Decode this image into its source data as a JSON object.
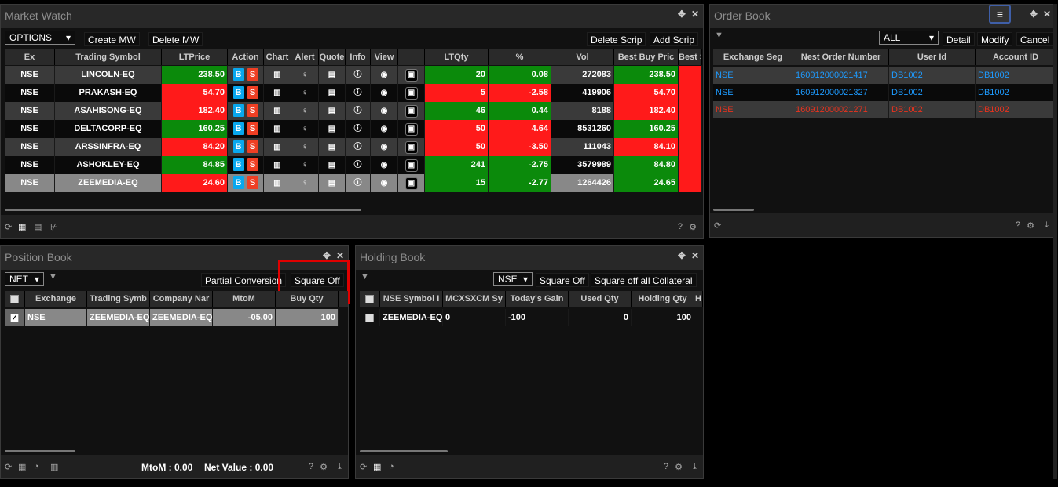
{
  "market_watch": {
    "title": "Market Watch",
    "mw_select": "OPTIONS",
    "create_mw": "Create MW",
    "delete_mw": "Delete MW",
    "delete_scrip": "Delete Scrip",
    "add_scrip": "Add Scrip",
    "columns": [
      "Ex",
      "Trading Symbol",
      "LTPrice",
      "Action",
      "Chart",
      "Alert",
      "Quote",
      "Info",
      "View",
      "",
      "LTQty",
      "%",
      "Vol",
      "Best Buy Pric",
      "Best S"
    ],
    "buy_label": "B",
    "sell_label": "S",
    "rows": [
      {
        "ex": "NSE",
        "sym": "LINCOLN-EQ",
        "ltp": "238.50",
        "ltp_c": "g",
        "ltq": "20",
        "ltq_c": "g",
        "pct": "0.08",
        "pct_c": "g",
        "vol": "272083",
        "bb": "238.50",
        "bb_c": "g"
      },
      {
        "ex": "NSE",
        "sym": "PRAKASH-EQ",
        "ltp": "54.70",
        "ltp_c": "rd",
        "ltq": "5",
        "ltq_c": "rd",
        "pct": "-2.58",
        "pct_c": "rd",
        "vol": "419906",
        "bb": "54.70",
        "bb_c": "rd"
      },
      {
        "ex": "NSE",
        "sym": "ASAHISONG-EQ",
        "ltp": "182.40",
        "ltp_c": "rd",
        "ltq": "46",
        "ltq_c": "g",
        "pct": "0.44",
        "pct_c": "g",
        "vol": "8188",
        "bb": "182.40",
        "bb_c": "rd"
      },
      {
        "ex": "NSE",
        "sym": "DELTACORP-EQ",
        "ltp": "160.25",
        "ltp_c": "g",
        "ltq": "50",
        "ltq_c": "rd",
        "pct": "4.64",
        "pct_c": "rd",
        "vol": "8531260",
        "bb": "160.25",
        "bb_c": "g"
      },
      {
        "ex": "NSE",
        "sym": "ARSSINFRA-EQ",
        "ltp": "84.20",
        "ltp_c": "rd",
        "ltq": "50",
        "ltq_c": "rd",
        "pct": "-3.50",
        "pct_c": "rd",
        "vol": "111043",
        "bb": "84.10",
        "bb_c": "rd"
      },
      {
        "ex": "NSE",
        "sym": "ASHOKLEY-EQ",
        "ltp": "84.85",
        "ltp_c": "g",
        "ltq": "241",
        "ltq_c": "g",
        "pct": "-2.75",
        "pct_c": "g",
        "vol": "3579989",
        "bb": "84.80",
        "bb_c": "g"
      },
      {
        "ex": "NSE",
        "sym": "ZEEMEDIA-EQ",
        "ltp": "24.60",
        "ltp_c": "rd",
        "ltq": "15",
        "ltq_c": "g",
        "pct": "-2.77",
        "pct_c": "g",
        "vol": "1264426",
        "bb": "24.65",
        "bb_c": "g"
      }
    ]
  },
  "order_book": {
    "title": "Order Book",
    "filter": "ALL",
    "detail": "Detail",
    "modify": "Modify",
    "cancel": "Cancel",
    "columns": [
      "Exchange Seg",
      "Nest Order Number",
      "User Id",
      "Account ID"
    ],
    "rows": [
      {
        "seg": "NSE",
        "num": "160912000021417",
        "uid": "DB1002",
        "acc": "DB1002",
        "color": "#1e9bff"
      },
      {
        "seg": "NSE",
        "num": "160912000021327",
        "uid": "DB1002",
        "acc": "DB1002",
        "color": "#1e9bff"
      },
      {
        "seg": "NSE",
        "num": "160912000021271",
        "uid": "DB1002",
        "acc": "DB1002",
        "color": "#e8321e"
      }
    ]
  },
  "position_book": {
    "title": "Position Book",
    "filter": "NET",
    "partial_conversion": "Partial Conversion",
    "square_off": "Square Off",
    "columns": [
      "Exchange",
      "Trading Symb",
      "Company Nar",
      "MtoM",
      "Buy Qty"
    ],
    "rows": [
      {
        "ex": "NSE",
        "sym": "ZEEMEDIA-EQ",
        "company": "ZEEMEDIA-EQ",
        "mtom": "-05.00",
        "buyqty": "100"
      }
    ],
    "mtom_label": "MtoM : 0.00",
    "net_value_label": "Net Value : 0.00"
  },
  "holding_book": {
    "title": "Holding Book",
    "exchange": "NSE",
    "square_off": "Square Off",
    "square_off_all": "Square off all Collateral",
    "columns": [
      "NSE Symbol I",
      "MCXSXCM Sy",
      "Today's Gain",
      "Used Qty",
      "Holding Qty",
      "H"
    ],
    "rows": [
      {
        "sym": "ZEEMEDIA-EQ",
        "mcx": "0",
        "gain": "-100",
        "used": "0",
        "holding": "100"
      }
    ]
  },
  "colors": {
    "green": "#0b8a0b",
    "red": "#ff1a1a",
    "highlight": "#e00000",
    "link_blue": "#1e9bff"
  }
}
